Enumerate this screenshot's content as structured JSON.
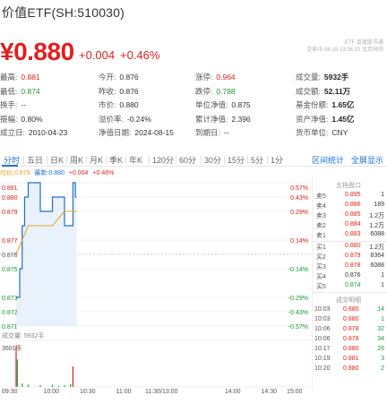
{
  "header": {
    "fund_name": "价值ETF(SH:510030)",
    "price": "¥0.880",
    "change_amount": "+0.004",
    "change_percent": "+0.46%",
    "source_line1": "ETF 百度股市通",
    "source_line2": "交易中 08-15 13:26:33 北京时间"
  },
  "quote": {
    "rows": [
      [
        {
          "label": "最高:",
          "value": "0.881",
          "color": "red"
        },
        {
          "label": "今开:",
          "value": "0.876",
          "color": "default"
        },
        {
          "label": "涨停:",
          "value": "0.964",
          "color": "red"
        },
        {
          "label": "成交量:",
          "value": "5932手",
          "color": "bold"
        }
      ],
      [
        {
          "label": "最低:",
          "value": "0.874",
          "color": "green"
        },
        {
          "label": "昨收:",
          "value": "0.876",
          "color": "default"
        },
        {
          "label": "跌停:",
          "value": "0.788",
          "color": "green"
        },
        {
          "label": "成交额:",
          "value": "52.11万",
          "color": "bold"
        }
      ],
      [
        {
          "label": "换手:",
          "value": "--",
          "color": "default"
        },
        {
          "label": "市价:",
          "value": "0.880",
          "color": "default"
        },
        {
          "label": "单位净值:",
          "value": "0.875",
          "color": "default"
        },
        {
          "label": "基金份额:",
          "value": "1.65亿",
          "color": "bold"
        }
      ],
      [
        {
          "label": "振幅:",
          "value": "0.80%",
          "color": "default"
        },
        {
          "label": "溢价率:",
          "value": "-0.24%",
          "color": "default"
        },
        {
          "label": "累计净值:",
          "value": "2.396",
          "color": "default"
        },
        {
          "label": "资产净值:",
          "value": "1.45亿",
          "color": "bold"
        }
      ],
      [
        {
          "label": "成立日:",
          "value": "2010-04-23",
          "color": "default"
        },
        {
          "label": "净值日期:",
          "value": "2024-08-15",
          "color": "default"
        },
        {
          "label": "到期日:",
          "value": "--",
          "color": "default"
        },
        {
          "label": "货币单位:",
          "value": "CNY",
          "color": "default"
        }
      ]
    ]
  },
  "tabs": {
    "items": [
      "分时",
      "五日",
      "日K",
      "周K",
      "月K",
      "季K",
      "年K",
      "120分",
      "60分",
      "30分",
      "15分",
      "5分",
      "1分"
    ],
    "active": 0,
    "right1": "区间统计",
    "right2": "全屏显示"
  },
  "legend": {
    "a": "均价:0.879",
    "b": "最新:0.880",
    "c": "+0.004",
    "d": "+0.46%"
  },
  "chart_data": {
    "type": "line",
    "title": "",
    "y_left_ticks": [
      "0.881",
      "0.880",
      "0.879",
      "0.877",
      "0.876",
      "0.875",
      "0.873",
      "0.872",
      "0.871"
    ],
    "y_right_ticks": [
      "0.57%",
      "0.43%",
      "0.29%",
      "0.14%",
      "-0.14%",
      "-0.29%",
      "-0.43%",
      "-0.57%"
    ],
    "x_ticks": [
      "09:30",
      "10:00",
      "10:30",
      "11:00",
      "11:30/13:00",
      "14:00",
      "14:30",
      "15:00"
    ],
    "ylim": [
      0.871,
      0.881
    ],
    "prev_close": 0.876,
    "price_series": {
      "name": "最新",
      "x": [
        "09:30",
        "09:31",
        "09:33",
        "09:35",
        "09:37",
        "09:38",
        "09:40",
        "09:45",
        "09:50",
        "09:55",
        "10:00",
        "10:02",
        "10:05",
        "10:10",
        "10:15",
        "10:17",
        "10:19",
        "10:20"
      ],
      "values": [
        0.873,
        0.873,
        0.875,
        0.878,
        0.88,
        0.88,
        0.881,
        0.881,
        0.879,
        0.879,
        0.88,
        0.88,
        0.88,
        0.878,
        0.878,
        0.881,
        0.88,
        0.88
      ]
    },
    "avg_series": {
      "name": "均价",
      "x": [
        "09:30",
        "09:40",
        "09:50",
        "10:00",
        "10:10",
        "10:20"
      ],
      "values": [
        0.876,
        0.878,
        0.878,
        0.878,
        0.879,
        0.879
      ]
    },
    "volume_label": "成交量: 5932手",
    "volume_max_label": "3601手",
    "volume": {
      "x": [
        "09:30",
        "09:31",
        "09:35",
        "09:40",
        "09:50",
        "10:00",
        "10:05",
        "10:10",
        "10:15",
        "10:17"
      ],
      "values": [
        3601,
        2400,
        300,
        200,
        150,
        200,
        100,
        150,
        250,
        1800
      ]
    }
  },
  "orderbook": {
    "asks_title": "五档盘口",
    "asks": [
      {
        "label": "卖5",
        "price": "0.895",
        "vol": "1"
      },
      {
        "label": "卖4",
        "price": "0.886",
        "vol": "189"
      },
      {
        "label": "卖3",
        "price": "0.885",
        "vol": "1.2万"
      },
      {
        "label": "卖2",
        "price": "0.884",
        "vol": "1.2万"
      },
      {
        "label": "卖1",
        "price": "0.883",
        "vol": "6088"
      }
    ],
    "bids": [
      {
        "label": "买1",
        "price": "0.880",
        "vol": "1.2万"
      },
      {
        "label": "买2",
        "price": "0.879",
        "vol": "8364"
      },
      {
        "label": "买3",
        "price": "0.878",
        "vol": "6088"
      },
      {
        "label": "买4",
        "price": "0.876",
        "vol": "1"
      },
      {
        "label": "买5",
        "price": "0.874",
        "vol": "1"
      }
    ],
    "trades_title": "成交明细",
    "trades": [
      {
        "time": "10:03",
        "price": "0.880",
        "vol": "14"
      },
      {
        "time": "10:03",
        "price": "0.880",
        "vol": "1"
      },
      {
        "time": "10:06",
        "price": "0.878",
        "vol": "32"
      },
      {
        "time": "10:06",
        "price": "0.878",
        "vol": "34"
      },
      {
        "time": "10:17",
        "price": "0.880",
        "vol": "26"
      },
      {
        "time": "10:19",
        "price": "0.881",
        "vol": "3"
      },
      {
        "time": "10:20",
        "price": "0.880",
        "vol": "2"
      }
    ]
  },
  "colors": {
    "up": "#e02020",
    "down": "#1a9a3a",
    "price_line": "#1f6fd1",
    "avg_line": "#f0a020",
    "fill": "#e8f1fc"
  }
}
